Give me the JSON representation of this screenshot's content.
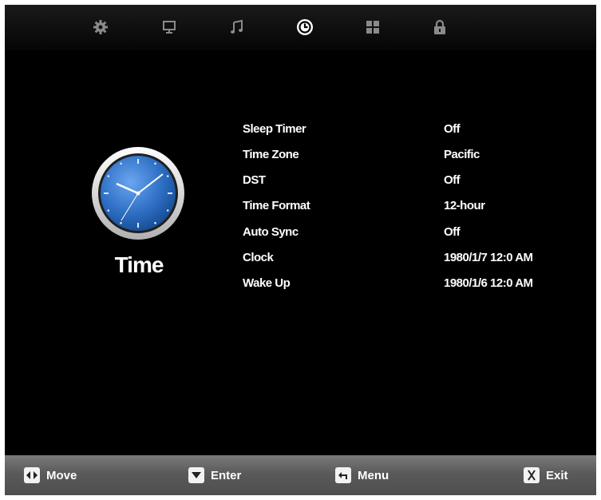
{
  "nav": {
    "icons": [
      "settings-icon",
      "picture-icon",
      "audio-icon",
      "time-icon",
      "apps-icon",
      "lock-icon"
    ],
    "active": "time-icon"
  },
  "section": {
    "title": "Time"
  },
  "menu": {
    "rows": [
      {
        "label": "Sleep Timer",
        "value": "Off"
      },
      {
        "label": "Time Zone",
        "value": "Pacific"
      },
      {
        "label": "DST",
        "value": "Off"
      },
      {
        "label": "Time Format",
        "value": "12-hour"
      },
      {
        "label": "Auto Sync",
        "value": "Off"
      },
      {
        "label": "Clock",
        "value": "1980/1/7 12:0 AM"
      },
      {
        "label": "Wake Up",
        "value": "1980/1/6 12:0 AM"
      }
    ]
  },
  "footer": {
    "move": "Move",
    "enter": "Enter",
    "menu": "Menu",
    "exit": "Exit"
  },
  "colors": {
    "background": "#000000",
    "text": "#ffffff",
    "clock_face": "#2e6fc4",
    "bottom_bar": "#5a5a5a"
  }
}
